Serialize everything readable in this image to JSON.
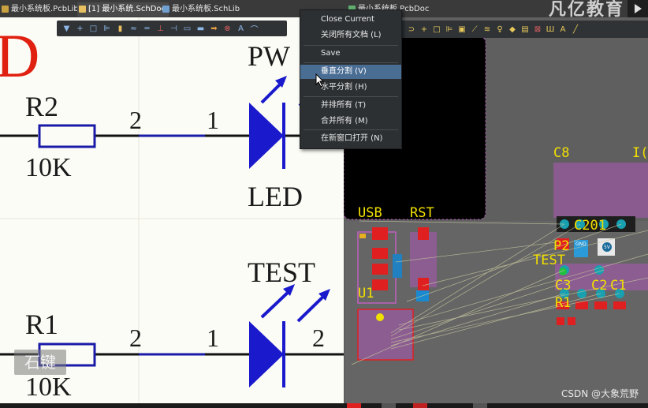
{
  "tabs": [
    {
      "label": "最小系统板.PcbLib",
      "icon_color": "#c8a040",
      "active": false
    },
    {
      "label": "[1] 最小系统.SchDoc",
      "icon_color": "#e8c060",
      "active": true
    },
    {
      "label": "最小系统板.SchLib",
      "icon_color": "#70a0d0",
      "active": false
    },
    {
      "label": "最小系统板.PcbDoc",
      "icon_color": "#60b070",
      "active": false
    }
  ],
  "brand": "凡亿教育",
  "context_menu": {
    "items": [
      {
        "label": "Close Current",
        "highlighted": false
      },
      {
        "label": "关闭所有文档 (L)",
        "highlighted": false
      },
      {
        "label": "Save",
        "highlighted": false
      },
      {
        "label": "垂直分割 (V)",
        "highlighted": true
      },
      {
        "label": "水平分割 (H)",
        "highlighted": false
      },
      {
        "label": "并排所有 (T)",
        "highlighted": false
      },
      {
        "label": "合并所有 (M)",
        "highlighted": false
      },
      {
        "label": "在新窗口打开 (N)",
        "highlighted": false
      }
    ]
  },
  "schematic": {
    "top_letter": "D",
    "r2_ref": "R2",
    "r2_val": "10K",
    "r1_ref": "R1",
    "r1_val": "10K",
    "pin2_top": "2",
    "pin1_top": "1",
    "pin2_bottom": "2",
    "pin1_bottom": "1",
    "pin2_right": "2",
    "led_top_name": "PW",
    "led_top_value": "LED",
    "led_bottom_name": "TEST",
    "key_watermark": "石键"
  },
  "pcb": {
    "labels": {
      "usb": "USB",
      "rst": "RST",
      "c8": "C8",
      "ic": "I(",
      "c201": "C201",
      "p2": "P2",
      "test": "TEST",
      "c3": "C3",
      "c2": "C2",
      "c1": "C1",
      "r1": "R1",
      "u1": "U1",
      "pad_gnd": "GND",
      "pad_5v": "5V"
    }
  },
  "credit": "CSDN @大象荒野"
}
